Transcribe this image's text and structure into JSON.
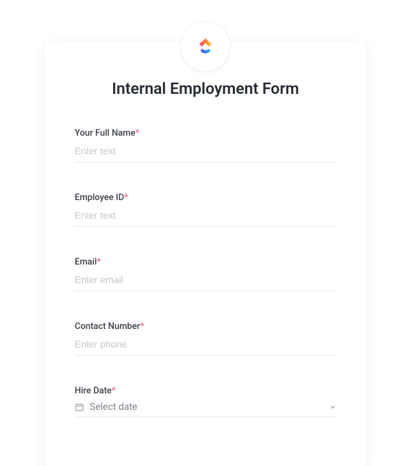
{
  "form": {
    "title": "Internal Employment Form",
    "required_marker": "*",
    "fields": {
      "full_name": {
        "label": "Your Full Name",
        "placeholder": "Enter text",
        "value": ""
      },
      "employee_id": {
        "label": "Employee ID",
        "placeholder": "Enter text",
        "value": ""
      },
      "email": {
        "label": "Email",
        "placeholder": "Enter email",
        "value": ""
      },
      "contact_number": {
        "label": "Contact Number",
        "placeholder": "Enter phone",
        "value": ""
      },
      "hire_date": {
        "label": "Hire Date",
        "placeholder": "Select date",
        "value": ""
      }
    }
  },
  "logo": {
    "name": "clickup-logo"
  }
}
